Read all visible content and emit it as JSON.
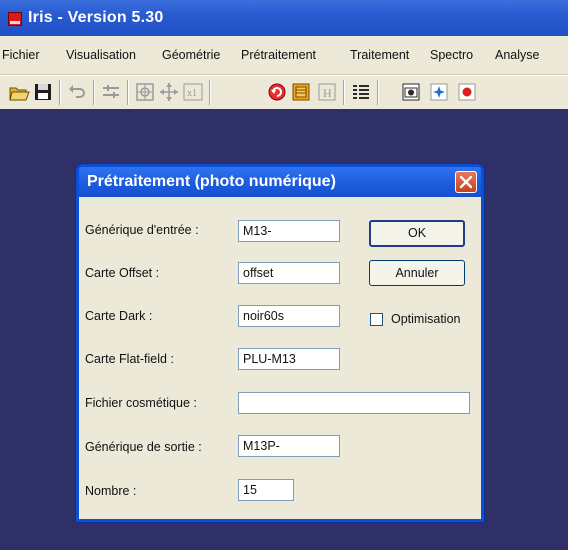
{
  "window": {
    "title": "Iris - Version 5.30"
  },
  "menu": [
    "Fichier",
    "Visualisation",
    "Géométrie",
    "Prétraitement",
    "Traitement",
    "Spectro",
    "Analyse"
  ],
  "toolbar": {
    "icons": [
      "open-folder-icon",
      "save-icon",
      "undo-icon",
      "threshold-icon",
      "zoom-grid-icon",
      "move-icon",
      "zoom-x1-icon",
      "rotate-icon",
      "palette-icon",
      "histogram-icon",
      "list-icon",
      "camera-icon",
      "star-icon",
      "record-icon"
    ]
  },
  "dialog": {
    "title": "Prétraitement (photo numérique)",
    "fields": {
      "input_generic": {
        "label": "Générique d'entrée :",
        "value": "M13-"
      },
      "offset": {
        "label": "Carte Offset :",
        "value": "offset"
      },
      "dark": {
        "label": "Carte Dark :",
        "value": "noir60s"
      },
      "flat": {
        "label": "Carte Flat-field :",
        "value": "PLU-M13"
      },
      "cosmetic": {
        "label": "Fichier cosmétique :",
        "value": ""
      },
      "output_generic": {
        "label": "Générique de sortie :",
        "value": "M13P-"
      },
      "count": {
        "label": "Nombre :",
        "value": "15"
      }
    },
    "ok_label": "OK",
    "cancel_label": "Annuler",
    "optimisation": {
      "label": "Optimisation",
      "checked": false
    }
  },
  "colors": {
    "titlebar": "#2a5bd0",
    "workspace": "#303068",
    "dialog_border": "#0a4fd6",
    "close_button": "#d9532f"
  }
}
